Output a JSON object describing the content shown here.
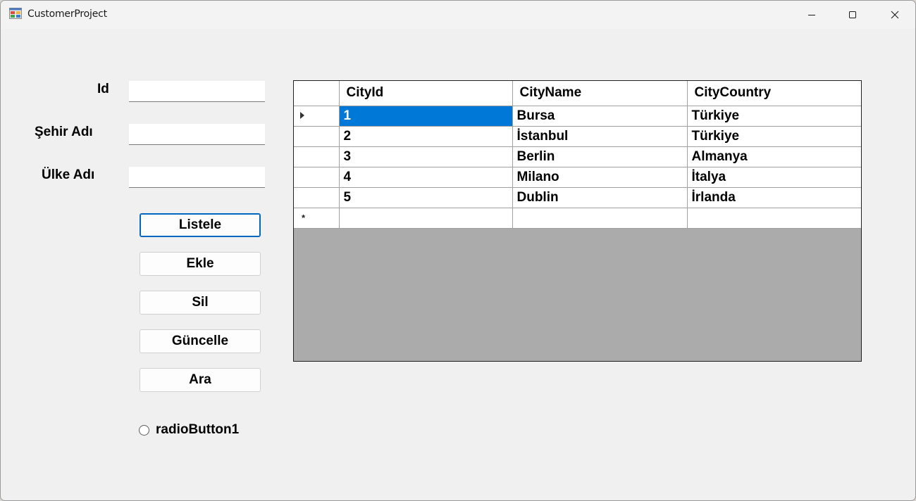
{
  "window": {
    "title": "CustomerProject",
    "icon": "winforms-app-icon",
    "controls": [
      "minimize-icon",
      "maximize-icon",
      "close-icon"
    ]
  },
  "form": {
    "labels": {
      "id": "Id",
      "city_name": "Şehir Adı",
      "country_name": "Ülke Adı"
    },
    "inputs": {
      "id_value": "",
      "city_name_value": "",
      "country_name_value": ""
    },
    "buttons": {
      "list": "Listele",
      "add": "Ekle",
      "delete": "Sil",
      "update": "Güncelle",
      "search": "Ara"
    },
    "radio": {
      "label": "radioButton1",
      "checked": false
    }
  },
  "grid": {
    "columns": [
      "CityId",
      "CityName",
      "CityCountry"
    ],
    "rows": [
      [
        "1",
        "Bursa",
        "Türkiye"
      ],
      [
        "2",
        "İstanbul",
        "Türkiye"
      ],
      [
        "3",
        "Berlin",
        "Almanya"
      ],
      [
        "4",
        "Milano",
        "İtalya"
      ],
      [
        "5",
        "Dublin",
        "İrlanda"
      ]
    ],
    "new_row_marker": "*",
    "selection_color": "#0078d7",
    "empty_area_color": "#ababab"
  }
}
